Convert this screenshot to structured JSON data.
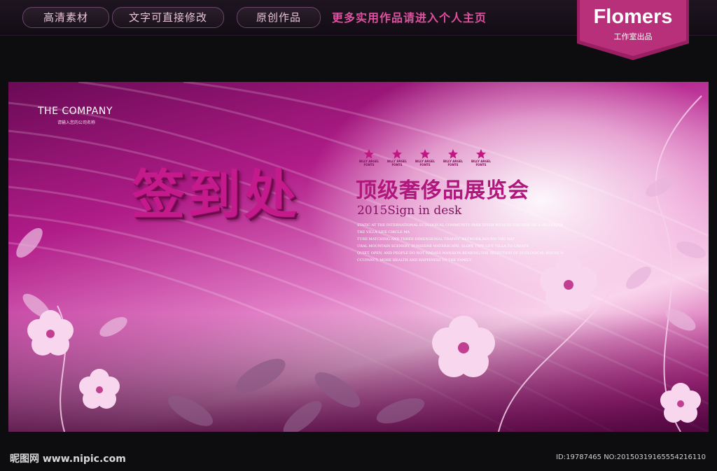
{
  "header": {
    "tags": [
      "高清素材",
      "文字可直接修改",
      "原创作品"
    ],
    "promo": "更多实用作品请进入个人主页",
    "brand": {
      "name": "Flomers",
      "tagline": "工作室出品"
    }
  },
  "poster": {
    "company": "THE COMPANY",
    "company_sub": "请输入您的公司名称",
    "title": "签到处",
    "subtitle": "顶级奢侈品展览会",
    "year_line": "2015Sign in desk",
    "star_labels": [
      "BILLY ARGEL FONTS",
      "BILLY ARGEL FONTS",
      "BILLY ARGEL FONTS",
      "BILLY ARGEL FONTS",
      "BILLY ARGEL FONTS"
    ],
    "description": [
      "STATIC AT THE INTERNATIONAL ECOLOGICAL COMMUNITY PARK RIVER WEALTH THE SIDE OF A HILLENJOY",
      "THE VILLA LIFE CIRCLE MA",
      "TURE MATCHING AND THREE-DIMENSIONAL TRAFFIC NETWORK,ROUND THE NAT",
      "URAL MOUNTAIN SCENERY, SUNSHINE WATERSCAPE, SLOPE TYPE LIFT VILLA,TO CREATE",
      "QUIET, OPEN, AND PEOPLE DO NOT HARASS MANSION BEARING,THE SELECTION OF ECOLOGICAL HOUSE O",
      "CCUPANCY, MORE HEALTH AND HAPPINESS TO THE FAMILY."
    ]
  },
  "footer": {
    "site": "昵图网 www.nipic.com",
    "id_line": "ID:19787465 NO:20150319165554216110"
  },
  "colors": {
    "accent": "#c41a8c",
    "brand_bg": "#9a1f62"
  }
}
